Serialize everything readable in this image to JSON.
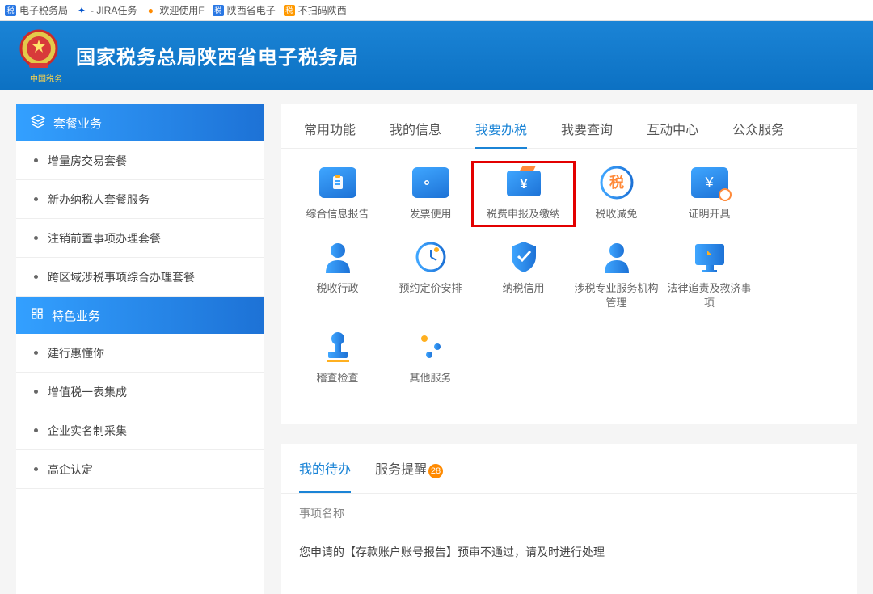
{
  "browser_tabs": [
    {
      "icon": "blue",
      "icon_text": "税",
      "label": "电子税务局"
    },
    {
      "icon": "jira",
      "icon_text": "✦",
      "label": "- JIRA任务"
    },
    {
      "icon": "ff",
      "icon_text": "●",
      "label": "欢迎使用F"
    },
    {
      "icon": "blue",
      "icon_text": "税",
      "label": "陕西省电子"
    },
    {
      "icon": "orange",
      "icon_text": "税",
      "label": "不扫码陕西"
    }
  ],
  "header": {
    "title": "国家税务总局陕西省电子税务局",
    "emblem_label": "中国税务"
  },
  "sidebar": {
    "sections": [
      {
        "type": "header",
        "icon": "layers",
        "label": "套餐业务"
      },
      {
        "type": "item",
        "label": "增量房交易套餐"
      },
      {
        "type": "item",
        "label": "新办纳税人套餐服务"
      },
      {
        "type": "item",
        "label": "注销前置事项办理套餐"
      },
      {
        "type": "item",
        "label": "跨区域涉税事项综合办理套餐"
      },
      {
        "type": "header",
        "icon": "grid",
        "label": "特色业务"
      },
      {
        "type": "item",
        "label": "建行惠懂你"
      },
      {
        "type": "item",
        "label": "增值税一表集成"
      },
      {
        "type": "item",
        "label": "企业实名制采集"
      },
      {
        "type": "item",
        "label": "高企认定"
      }
    ]
  },
  "main_tabs": [
    {
      "label": "常用功能",
      "active": false
    },
    {
      "label": "我的信息",
      "active": false
    },
    {
      "label": "我要办税",
      "active": true
    },
    {
      "label": "我要查询",
      "active": false
    },
    {
      "label": "互动中心",
      "active": false
    },
    {
      "label": "公众服务",
      "active": false
    }
  ],
  "services": [
    {
      "key": "report",
      "label": "综合信息报告",
      "icon": "clipboard"
    },
    {
      "key": "invoice",
      "label": "发票使用",
      "icon": "ticket"
    },
    {
      "key": "taxpay",
      "label": "税费申报及缴纳",
      "icon": "yen-folder",
      "highlighted": true
    },
    {
      "key": "reduce",
      "label": "税收减免",
      "icon": "tax-circle"
    },
    {
      "key": "cert",
      "label": "证明开具",
      "icon": "stamp-doc"
    },
    {
      "key": "admin",
      "label": "税收行政",
      "icon": "person"
    },
    {
      "key": "pricing",
      "label": "预约定价安排",
      "icon": "clock"
    },
    {
      "key": "credit",
      "label": "纳税信用",
      "icon": "shield"
    },
    {
      "key": "agency",
      "label": "涉税专业服务机构管理",
      "icon": "person"
    },
    {
      "key": "legal",
      "label": "法律追责及救济事项",
      "icon": "monitor"
    },
    {
      "key": "audit",
      "label": "稽查检查",
      "icon": "stamp"
    },
    {
      "key": "other",
      "label": "其他服务",
      "icon": "sliders"
    }
  ],
  "todo_tabs": [
    {
      "label": "我的待办",
      "active": true,
      "badge": null
    },
    {
      "label": "服务提醒",
      "active": false,
      "badge": 28
    }
  ],
  "todo": {
    "column": "事项名称",
    "row": "您申请的【存款账户账号报告】预审不通过，请及时进行处理"
  }
}
